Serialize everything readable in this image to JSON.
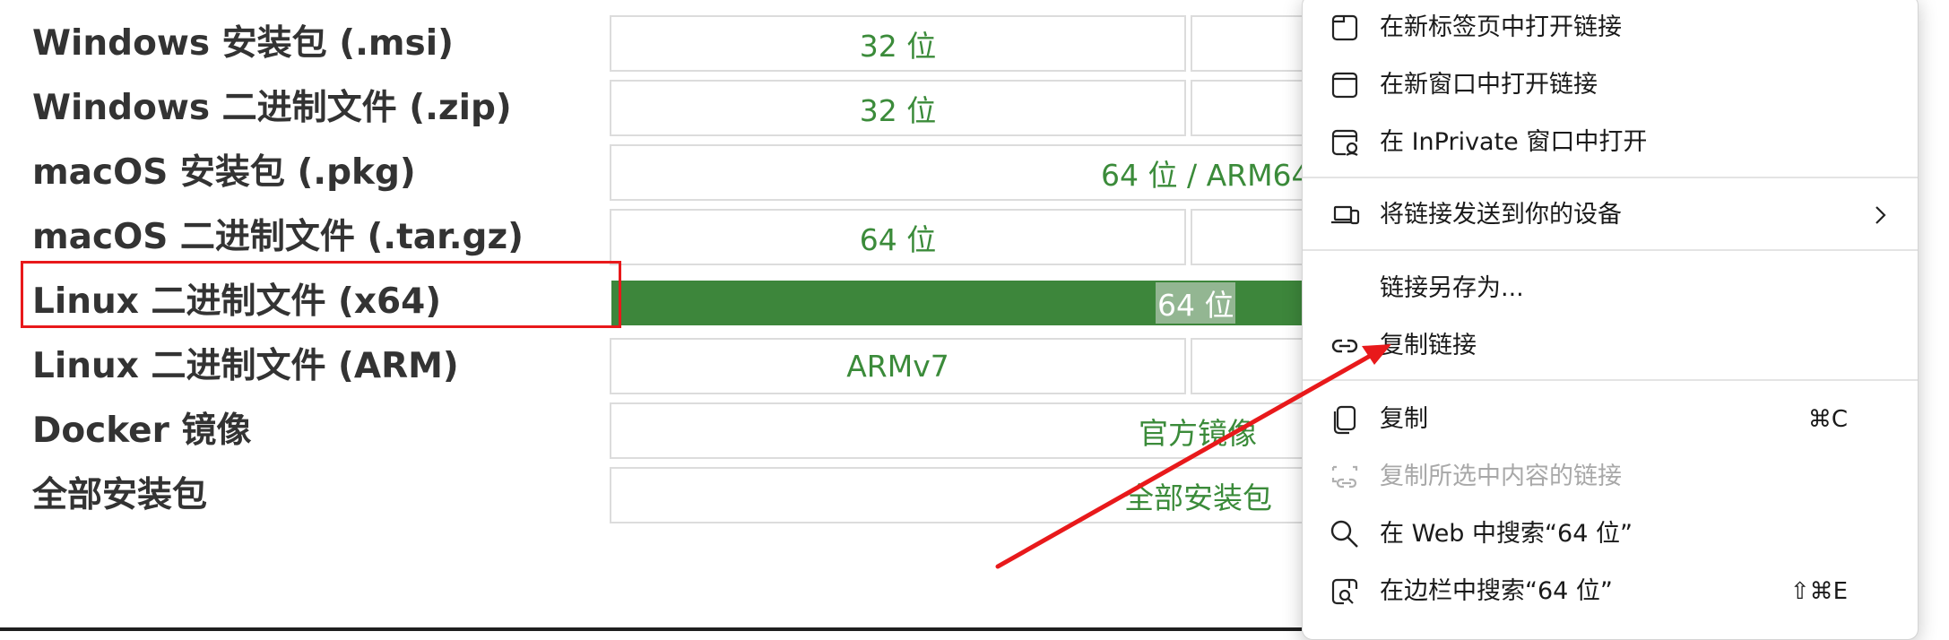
{
  "downloads": {
    "rows": [
      {
        "label": "Windows 安装包 (.msi)",
        "cells": [
          "32 位",
          ""
        ]
      },
      {
        "label": "Windows 二进制文件 (.zip)",
        "cells": [
          "32 位",
          ""
        ]
      },
      {
        "label": "macOS 安装包 (.pkg)",
        "cells": [
          "64 位 / ARM64"
        ]
      },
      {
        "label": "macOS 二进制文件 (.tar.gz)",
        "cells": [
          "64 位",
          ""
        ]
      },
      {
        "label": "Linux 二进制文件 (x64)",
        "cells": [
          "64 位"
        ]
      },
      {
        "label": "Linux 二进制文件 (ARM)",
        "cells": [
          "ARMv7",
          ""
        ]
      },
      {
        "label": "Docker 镜像",
        "cells": [
          "官方镜像"
        ]
      },
      {
        "label": "全部安装包",
        "cells": [
          "全部安装包"
        ]
      }
    ]
  },
  "context_menu": {
    "items": [
      {
        "label": "在新标签页中打开链接",
        "icon": "new-tab-icon"
      },
      {
        "label": "在新窗口中打开链接",
        "icon": "new-window-icon"
      },
      {
        "label": "在 InPrivate 窗口中打开",
        "icon": "inprivate-icon"
      },
      {
        "label": "将链接发送到你的设备",
        "icon": "send-to-devices-icon",
        "submenu": true
      },
      {
        "label": "链接另存为...",
        "icon": ""
      },
      {
        "label": "复制链接",
        "icon": "link-icon"
      },
      {
        "label": "复制",
        "icon": "copy-icon",
        "shortcut": "⌘C"
      },
      {
        "label": "复制所选中内容的链接",
        "icon": "copy-link-to-highlight-icon",
        "disabled": true
      },
      {
        "label": "在 Web 中搜索“64 位”",
        "icon": "search-icon"
      },
      {
        "label": "在边栏中搜索“64 位”",
        "icon": "sidebar-search-icon",
        "shortcut": "⇧⌘E"
      }
    ]
  },
  "colors": {
    "link_green": "#3b8b3a",
    "selected_row_bg": "#3d863b",
    "annotation_red": "#e8191b"
  }
}
